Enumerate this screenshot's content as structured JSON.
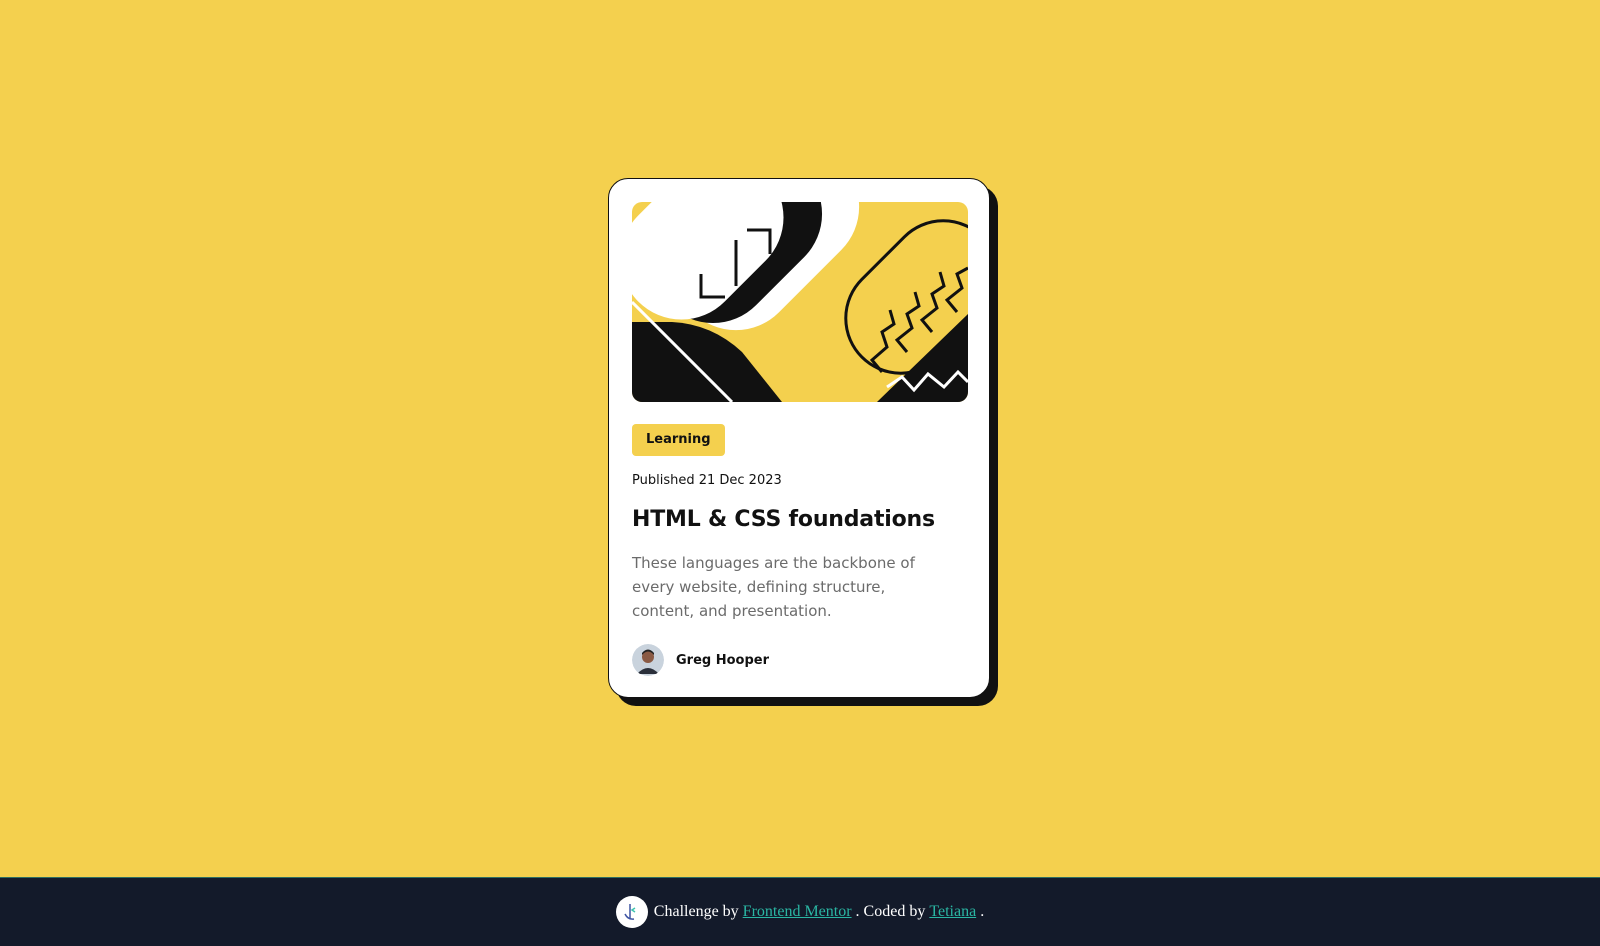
{
  "card": {
    "tag": "Learning",
    "published": "Published 21 Dec 2023",
    "title": "HTML & CSS foundations",
    "description": "These languages are the backbone of every website, defining structure, content, and presentation.",
    "author": "Greg Hooper",
    "image_icon": "html-css-illustration-icon",
    "avatar_icon": "avatar-icon"
  },
  "footer": {
    "challenge_prefix": "Challenge by",
    "challenge_link": "Frontend Mentor",
    "coded_prefix": ". Coded by",
    "coded_link": "Tetiana",
    "suffix": ".",
    "logo_icon": "frontend-mentor-logo-icon"
  },
  "colors": {
    "background": "#f4d04e",
    "card": "#ffffff",
    "ink": "#111111",
    "muted": "#6b6b6b",
    "footer": "#131a2a",
    "link": "#2ab6a3"
  }
}
